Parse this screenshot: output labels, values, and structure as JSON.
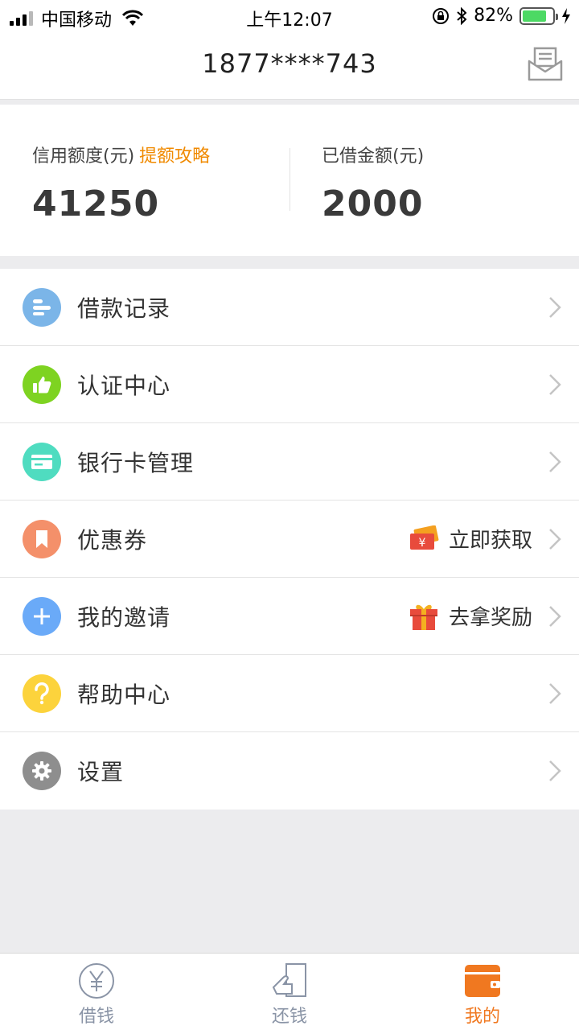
{
  "status_bar": {
    "carrier": "中国移动",
    "time": "上午12:07",
    "battery": "82%",
    "battery_level": 0.82
  },
  "header": {
    "title": "1877****743",
    "message_icon": "envelope-icon"
  },
  "credit": {
    "limit_label": "信用额度(元)",
    "limit_link": "提额攻略",
    "limit_value": "41250",
    "borrowed_label": "已借金额(元)",
    "borrowed_value": "2000"
  },
  "menu": {
    "items": [
      {
        "label": "借款记录",
        "icon": "list-icon",
        "color": "#7bb5e8"
      },
      {
        "label": "认证中心",
        "icon": "thumbs-up-icon",
        "color": "#7ed321"
      },
      {
        "label": "银行卡管理",
        "icon": "card-icon",
        "color": "#4fdcc0"
      },
      {
        "label": "优惠券",
        "icon": "bookmark-icon",
        "color": "#f4906a",
        "extra": "立即获取",
        "extra_icon": "coupon-icon"
      },
      {
        "label": "我的邀请",
        "icon": "plus-icon",
        "color": "#6aaaf8",
        "extra": "去拿奖励",
        "extra_icon": "gift-icon"
      },
      {
        "label": "帮助中心",
        "icon": "question-icon",
        "color": "#fcd33c"
      },
      {
        "label": "设置",
        "icon": "gear-icon",
        "color": "#8e8e8e"
      }
    ]
  },
  "tabs": [
    {
      "label": "借钱",
      "icon": "yen-icon",
      "active": false
    },
    {
      "label": "还钱",
      "icon": "repay-icon",
      "active": false
    },
    {
      "label": "我的",
      "icon": "wallet-icon",
      "active": true
    }
  ],
  "colors": {
    "accent": "#f08a00",
    "active_tab": "#f07820",
    "inactive_tab": "#8a94a6"
  }
}
